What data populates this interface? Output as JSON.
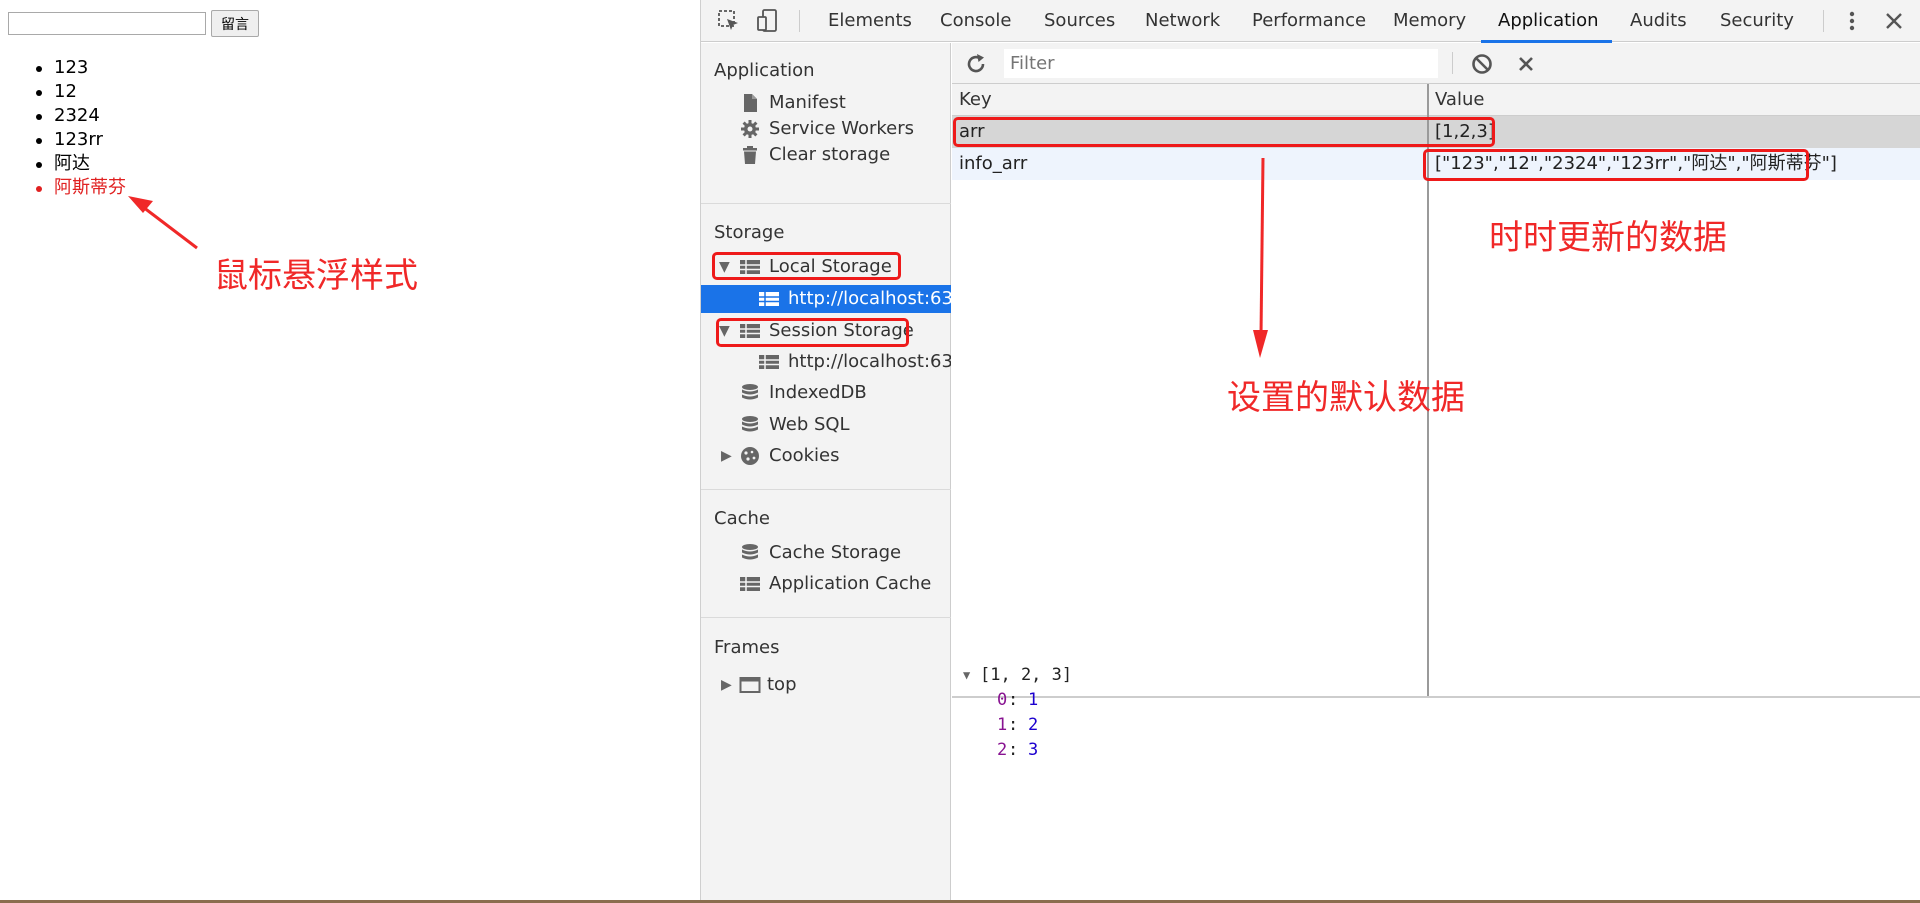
{
  "page": {
    "input_value": "",
    "button_label": "留言",
    "items": [
      "123",
      "12",
      "2324",
      "123rr",
      "阿达",
      "阿斯蒂芬"
    ]
  },
  "annotations": {
    "hover_style": "鼠标悬浮样式",
    "default_data": "设置的默认数据",
    "live_data": "时时更新的数据"
  },
  "devtools": {
    "tabs": [
      "Elements",
      "Console",
      "Sources",
      "Network",
      "Performance",
      "Memory",
      "Application",
      "Audits",
      "Security"
    ],
    "active_tab": "Application",
    "sidebar": {
      "application_heading": "Application",
      "manifest": "Manifest",
      "service_workers": "Service Workers",
      "clear_storage": "Clear storage",
      "storage_heading": "Storage",
      "local_storage": "Local Storage",
      "local_storage_origin": "http://localhost:633",
      "session_storage": "Session Storage",
      "session_storage_origin": "http://localhost:633",
      "indexeddb": "IndexedDB",
      "web_sql": "Web SQL",
      "cookies": "Cookies",
      "cache_heading": "Cache",
      "cache_storage": "Cache Storage",
      "application_cache": "Application Cache",
      "frames_heading": "Frames",
      "top": "top"
    },
    "filter_placeholder": "Filter",
    "grid": {
      "key_header": "Key",
      "value_header": "Value",
      "rows": [
        {
          "key": "arr",
          "value": "[1,2,3]"
        },
        {
          "key": "info_arr",
          "value": "[\"123\",\"12\",\"2324\",\"123rr\",\"阿达\",\"阿斯蒂芬\"]"
        }
      ]
    },
    "preview": {
      "summary": "[1, 2, 3]",
      "entries": [
        {
          "index": "0",
          "value": "1"
        },
        {
          "index": "1",
          "value": "2"
        },
        {
          "index": "2",
          "value": "3"
        }
      ]
    }
  },
  "colors": {
    "accent": "#1a73e8",
    "annotation": "#f02828"
  }
}
